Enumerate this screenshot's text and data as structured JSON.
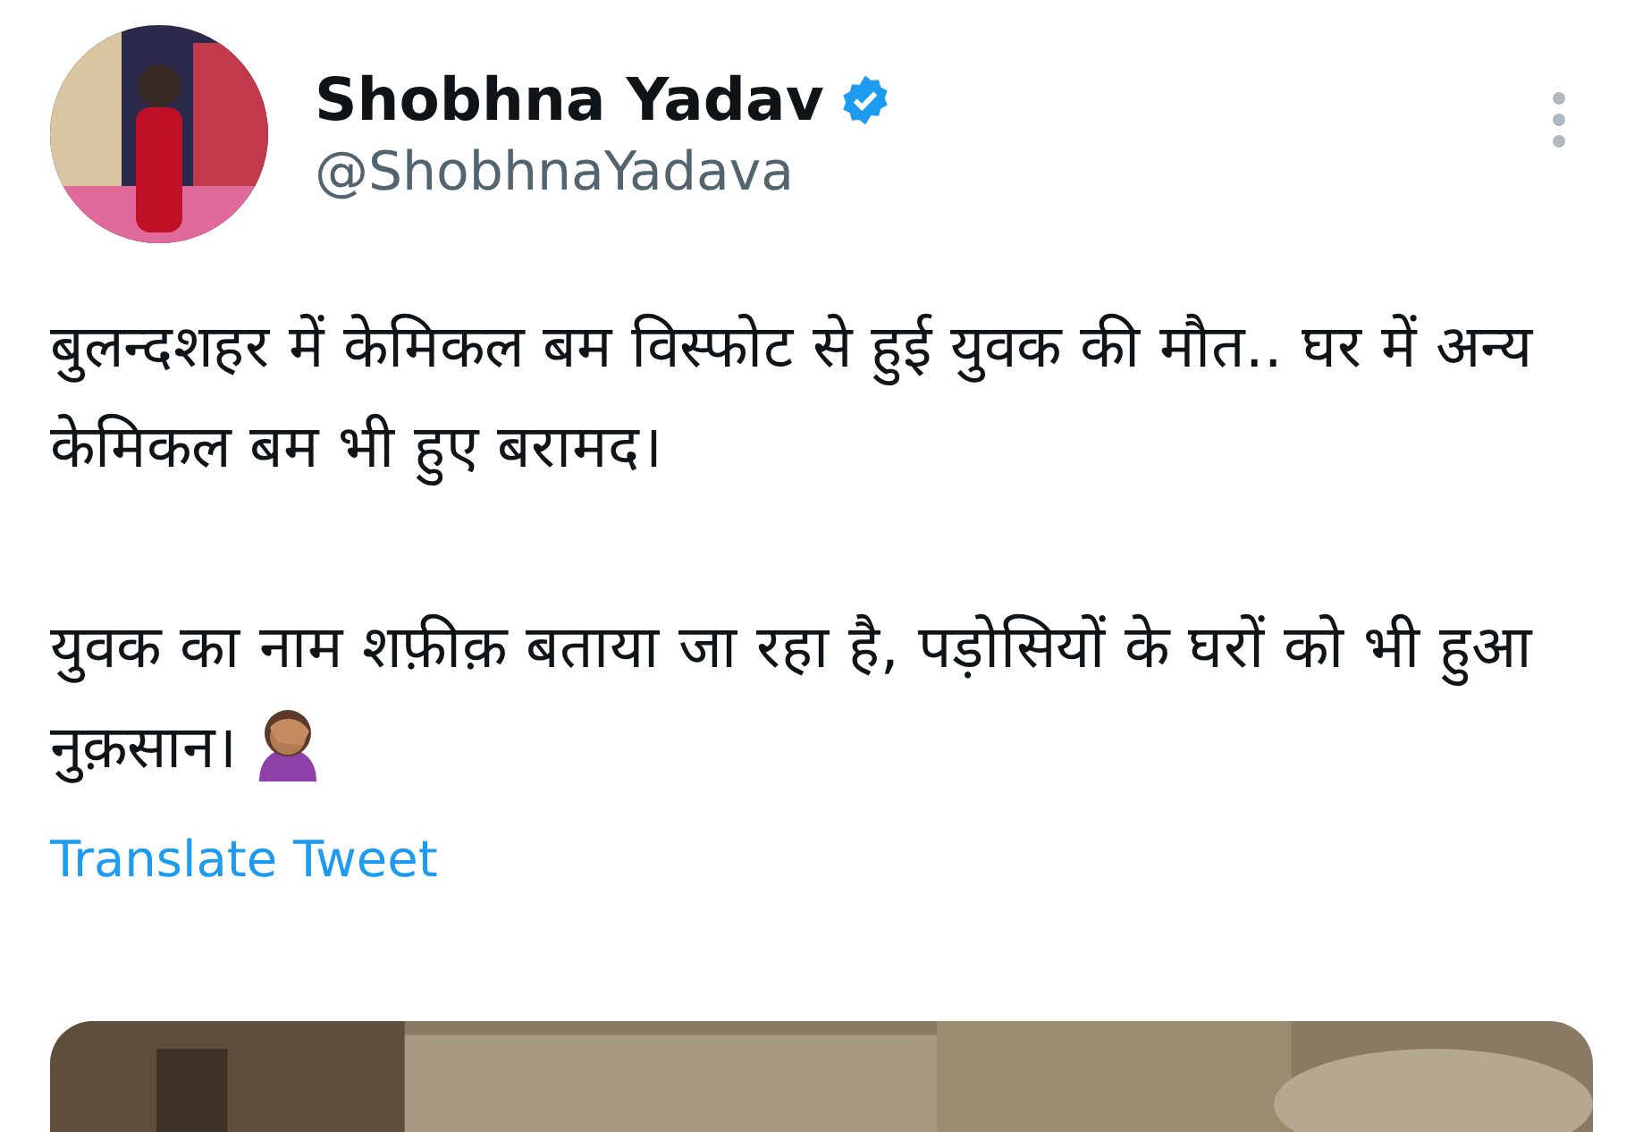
{
  "author": {
    "name": "Shobhna Yadav",
    "handle": "@ShobhnaYadava",
    "verified": true
  },
  "tweet": {
    "paragraphs": [
      "बुलन्दशहर में केमिकल बम विस्फोट से हुई युवक की मौत.. घर में अन्य केमिकल बम भी हुए बरामद।",
      "युवक का नाम शफ़ीक़ बताया जा रहा है, पड़ोसियों के घरों को भी हुआ नुक़सान।"
    ]
  },
  "translate_link": "Translate Tweet"
}
